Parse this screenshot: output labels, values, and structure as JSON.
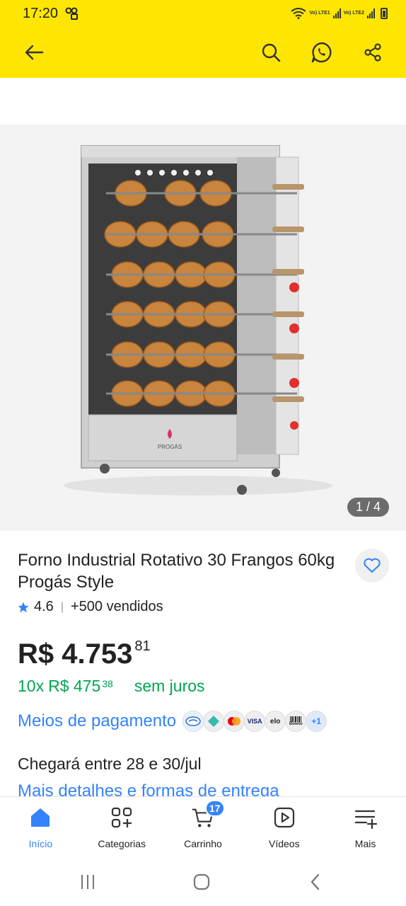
{
  "status_bar": {
    "time": "17:20",
    "sim1_label": "Vo) LTE1",
    "sim2_label": "Vo) LTE2"
  },
  "top_bar": {
    "back_icon": "arrow-left-icon",
    "search_icon": "search-icon",
    "whatsapp_icon": "whatsapp-icon",
    "share_icon": "share-icon",
    "background_color": "#ffe600"
  },
  "gallery": {
    "image_alt": "Forno Industrial Rotativo 30 Frangos",
    "brand_on_image": "PROGÁS",
    "counter": "1 / 4"
  },
  "product": {
    "title": "Forno Industrial Rotativo 30 Frangos 60kg Progás Style",
    "rating": "4.6",
    "sold": "+500 vendidos",
    "price_main": "R$ 4.753",
    "price_cents": "81",
    "installments_prefix": "10x",
    "installment_value": "R$ 475",
    "installment_cents": "38",
    "installments_suffix": "sem juros",
    "payments_link": "Meios de pagamento",
    "payment_methods": [
      "mercado-pago",
      "pix",
      "mastercard",
      "VISA",
      "elo",
      "Boleto",
      "+1"
    ],
    "delivery": "Chegará entre 28 e 30/jul",
    "delivery_link": "Mais detalhes e formas de entrega"
  },
  "bottom_nav": {
    "items": [
      {
        "label": "Início",
        "icon": "home-icon",
        "active": true
      },
      {
        "label": "Categorias",
        "icon": "categories-icon"
      },
      {
        "label": "Carrinho",
        "icon": "cart-icon",
        "badge": "17"
      },
      {
        "label": "Vídeos",
        "icon": "video-icon"
      },
      {
        "label": "Mais",
        "icon": "more-menu-icon"
      }
    ]
  },
  "colors": {
    "accent": "#3483fa",
    "green": "#00a650",
    "brand_yellow": "#ffe600"
  }
}
